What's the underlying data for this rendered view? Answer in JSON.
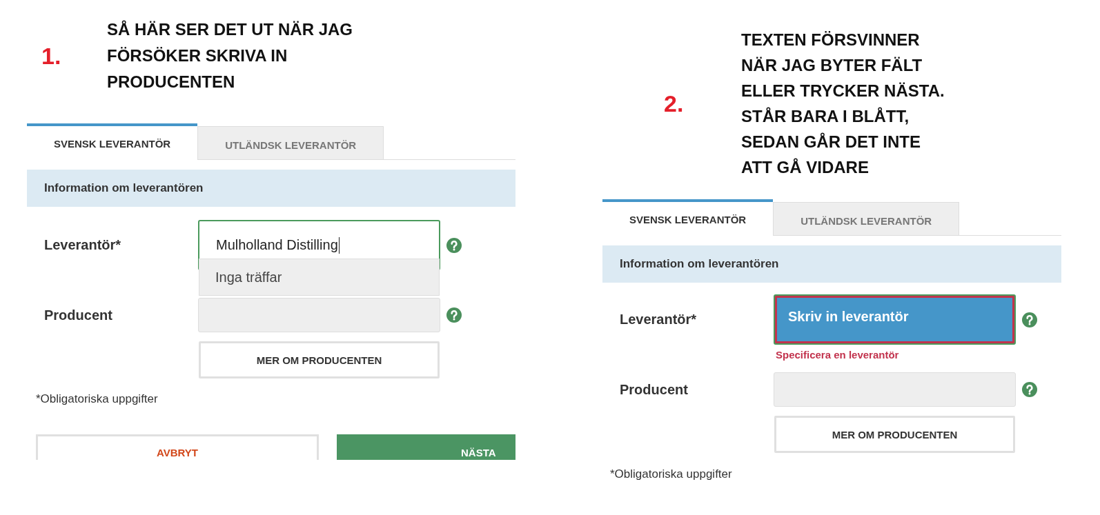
{
  "panels": [
    {
      "number": "1.",
      "caption": [
        "SÅ HÄR SER DET UT NÄR JAG",
        "FÖRSÖKER SKRIVA IN",
        "PRODUCENTEN"
      ],
      "form": {
        "tabs": [
          {
            "label": "SVENSK LEVERANTÖR",
            "selected": true
          },
          {
            "label": "UTLÄNDSK LEVERANTÖR",
            "selected": false
          }
        ],
        "section_title": "Information om leverantören",
        "fields": [
          {
            "kind": "autocomplete",
            "label": "Leverantör*",
            "value": "Mulholland Distilling",
            "focused": true,
            "invalid": false,
            "disabled": false,
            "dropdown_message": "Inga träffar"
          },
          {
            "kind": "text",
            "label": "Producent",
            "focused": false,
            "invalid": false,
            "disabled": true
          }
        ],
        "more_button": "MER OM PRODUCENTEN",
        "required_note": "*Obligatoriska uppgifter",
        "buttons": [
          {
            "kind": "cancel",
            "label": "AVBRYT"
          },
          {
            "kind": "next",
            "label": "NÄSTA"
          }
        ]
      }
    },
    {
      "number": "2.",
      "caption": [
        "TEXTEN FÖRSVINNER",
        "NÄR JAG BYTER FÄLT",
        "ELLER TRYCKER NÄSTA.",
        "STÅR BARA I BLÅTT,",
        "SEDAN GÅR DET INTE",
        "ATT GÅ VIDARE"
      ],
      "form": {
        "tabs": [
          {
            "label": "SVENSK LEVERANTÖR",
            "selected": true
          },
          {
            "label": "UTLÄNDSK LEVERANTÖR",
            "selected": false
          }
        ],
        "section_title": "Information om leverantören",
        "fields": [
          {
            "kind": "autocomplete",
            "label": "Leverantör*",
            "placeholder": "Skriv in leverantör",
            "focused": true,
            "invalid": true,
            "disabled": false,
            "error": "Specificera en leverantör"
          },
          {
            "kind": "text",
            "label": "Producent",
            "focused": false,
            "invalid": false,
            "disabled": true
          }
        ],
        "more_button": "MER OM PRODUCENTEN",
        "required_note": "*Obligatoriska uppgifter"
      }
    }
  ]
}
